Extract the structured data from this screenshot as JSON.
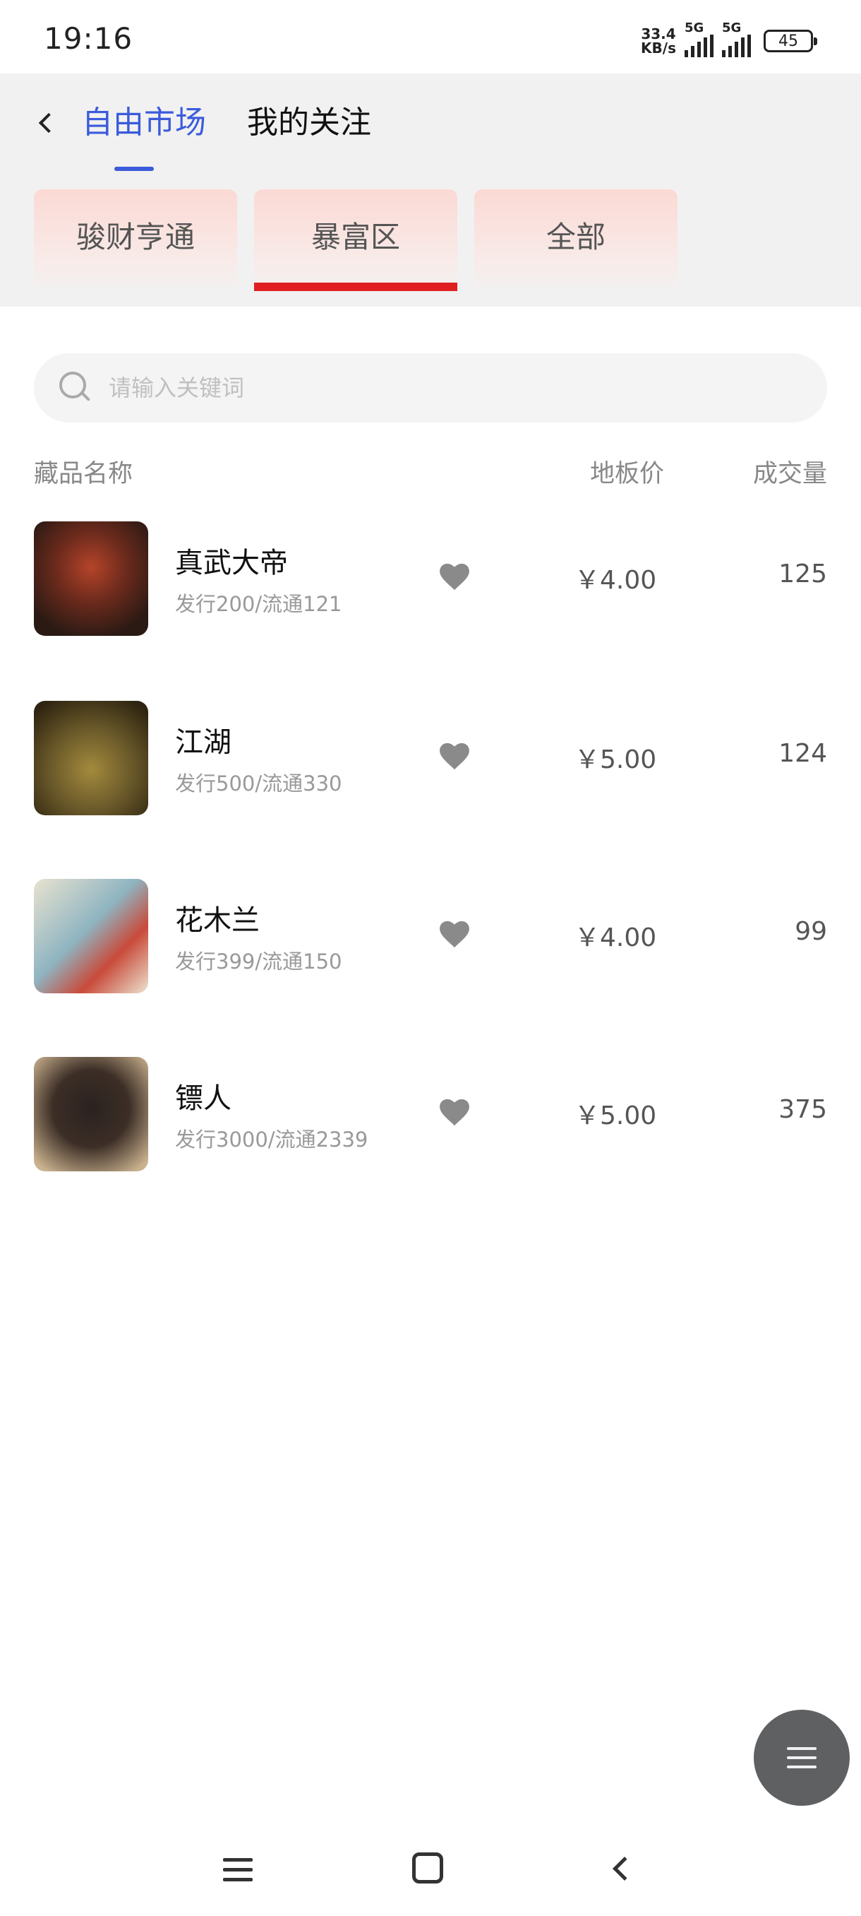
{
  "status": {
    "time": "19:16",
    "net_speed_value": "33.4",
    "net_speed_unit": "KB/s",
    "signal1_label": "5G",
    "signal2_label": "5G",
    "battery": "45"
  },
  "header": {
    "tabs": [
      {
        "label": "自由市场",
        "active": true
      },
      {
        "label": "我的关注",
        "active": false
      }
    ],
    "zones": [
      {
        "label": "骏财亨通",
        "active": false
      },
      {
        "label": "暴富区",
        "active": true
      },
      {
        "label": "全部",
        "active": false
      }
    ],
    "accent_color": "#3b5bdb",
    "zone_active_color": "#e02020"
  },
  "search": {
    "placeholder": "请输入关键词",
    "value": ""
  },
  "table": {
    "columns": {
      "name": "藏品名称",
      "price": "地板价",
      "volume": "成交量"
    },
    "items": [
      {
        "name": "真武大帝",
        "sub": "发行200/流通121",
        "price": "￥4.00",
        "volume": "125"
      },
      {
        "name": "江湖",
        "sub": "发行500/流通330",
        "price": "￥5.00",
        "volume": "124"
      },
      {
        "name": "花木兰",
        "sub": "发行399/流通150",
        "price": "￥4.00",
        "volume": "99"
      },
      {
        "name": "镖人",
        "sub": "发行3000/流通2339",
        "price": "￥5.00",
        "volume": "375"
      }
    ]
  },
  "icons": {
    "back": "chevron-left-icon",
    "search": "search-icon",
    "favorite": "heart-icon",
    "fab": "menu-icon"
  }
}
